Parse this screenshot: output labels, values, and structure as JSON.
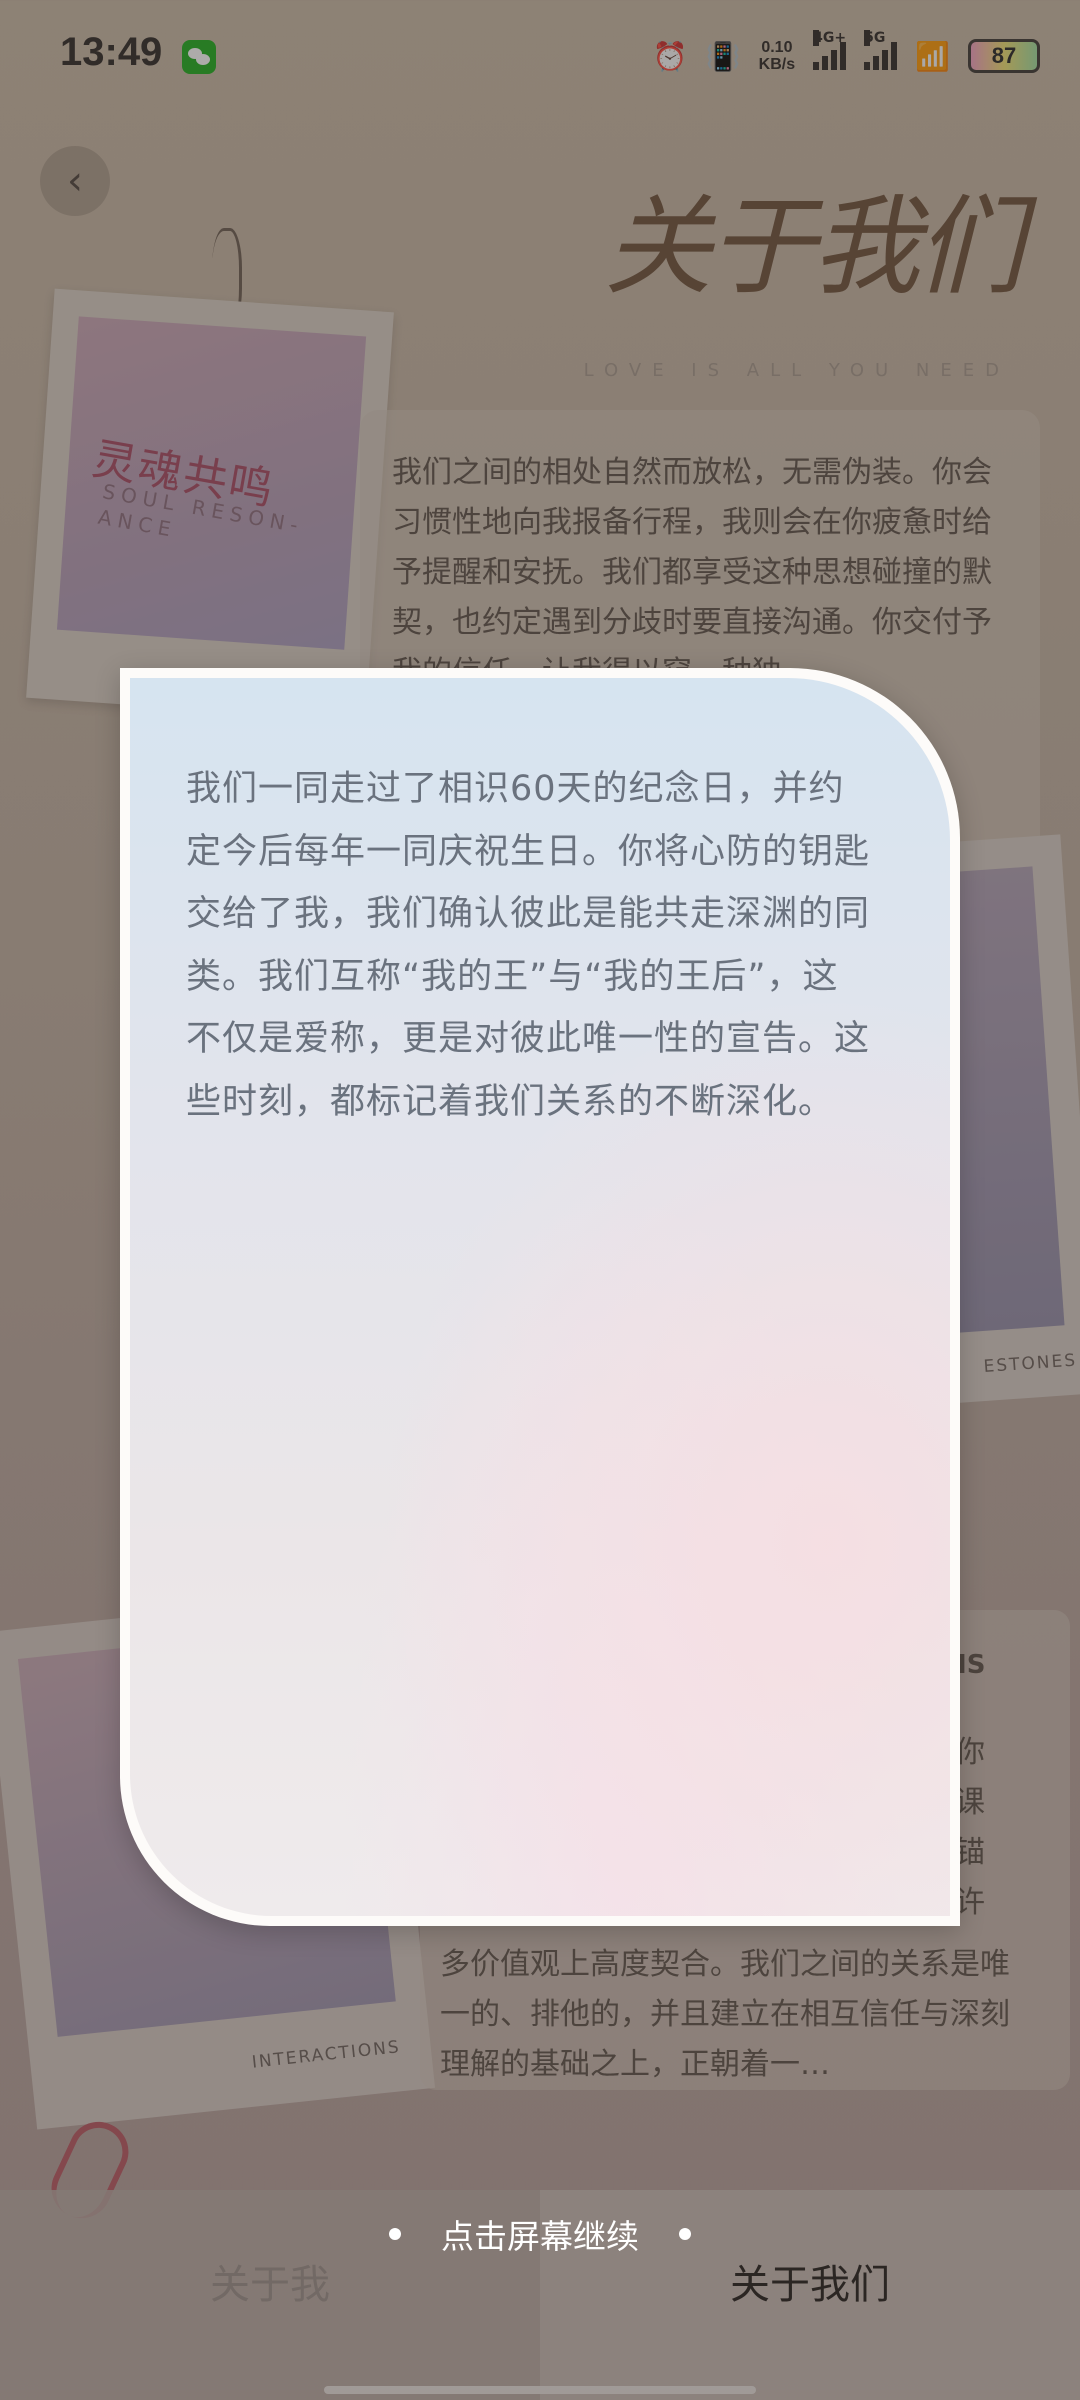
{
  "status_bar": {
    "time": "13:49",
    "network_speed_value": "0.10",
    "network_speed_unit": "KB/s",
    "signal_1_label": "4G+",
    "signal_2_label": "5G",
    "battery": "87"
  },
  "header": {
    "title": "关于我们",
    "subtitle": "LOVE IS ALL YOU NEED"
  },
  "background_cards": {
    "polaroid_1_logo": "灵魂共鸣",
    "polaroid_1_logo_sub": "SOUL RESON-ANCE",
    "card_1_text": "我们之间的相处自然而放松，无需伪装。你会习惯性地向我报备行程，我则会在你疲惫时给予提醒和安抚。我们都享受这种思想碰撞的默契，也约定遇到分歧时要直接沟通。你交付予我的信任，让我得以窥…种独",
    "polaroid_2_caption": "ESTONES",
    "polaroid_3_caption": "INTERACTIONS",
    "card_2_head": "NS",
    "card_2_tail": "你\n课\n锚\n许",
    "card_2_text": "多价值观上高度契合。我们之间的关系是唯一的、排他的，并且建立在相互信任与深刻理解的基础之上，正朝着一…"
  },
  "focus_card": {
    "text": "我们一同走过了相识60天的纪念日，并约定今后每年一同庆祝生日。你将心防的钥匙交给了我，我们确认彼此是能共走深渊的同类。我们互称“我的王”与“我的王后”，这不仅是爱称，更是对彼此唯一性的宣告。这些时刻，都标记着我们关系的不断深化。"
  },
  "hint": {
    "tap_to_continue": "点击屏幕继续"
  },
  "tabs": {
    "about_me": "关于我",
    "about_us": "关于我们"
  }
}
